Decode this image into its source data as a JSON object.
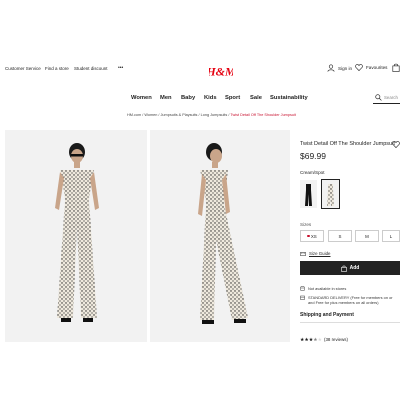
{
  "header": {
    "utility_links": [
      "Customer Service",
      "Find a store",
      "Student discount",
      "•••"
    ],
    "brand": "H&M",
    "sign_in": "Sign in",
    "favourites": "Favourites"
  },
  "nav": {
    "items": [
      "Women",
      "Men",
      "Baby",
      "Kids",
      "Sport",
      "Sale",
      "Sustainability"
    ],
    "search_placeholder": "Search"
  },
  "breadcrumb": {
    "items": [
      "HM.com",
      "Women",
      "Jumpsuits & Playsuits",
      "Long Jumpsuits"
    ],
    "current": "Twist Detail Off The Shoulder Jumpsuit",
    "separator": "/"
  },
  "product": {
    "title": "Twist Detail Off The Shoulder Jumpsuit",
    "price": "$69.99",
    "color_label": "Cream/Spot",
    "sizes_label": "Sizes",
    "sizes": [
      "XS",
      "S",
      "M",
      "L"
    ],
    "size_guide": "Size Guide",
    "add_button": "Add",
    "availability": "Not available in stores",
    "delivery_line1": "STANDARD DELIVERY (Free for members on or",
    "delivery_line2": "and Free for plus members on all orders)",
    "shipping_heading": "Shipping and Payment",
    "reviews": "(38 reviews)",
    "rating": 3.5
  },
  "colors": {
    "brand_red": "#e50010",
    "add_button_bg": "#222222",
    "unavailable_dot": "#c8102e"
  }
}
